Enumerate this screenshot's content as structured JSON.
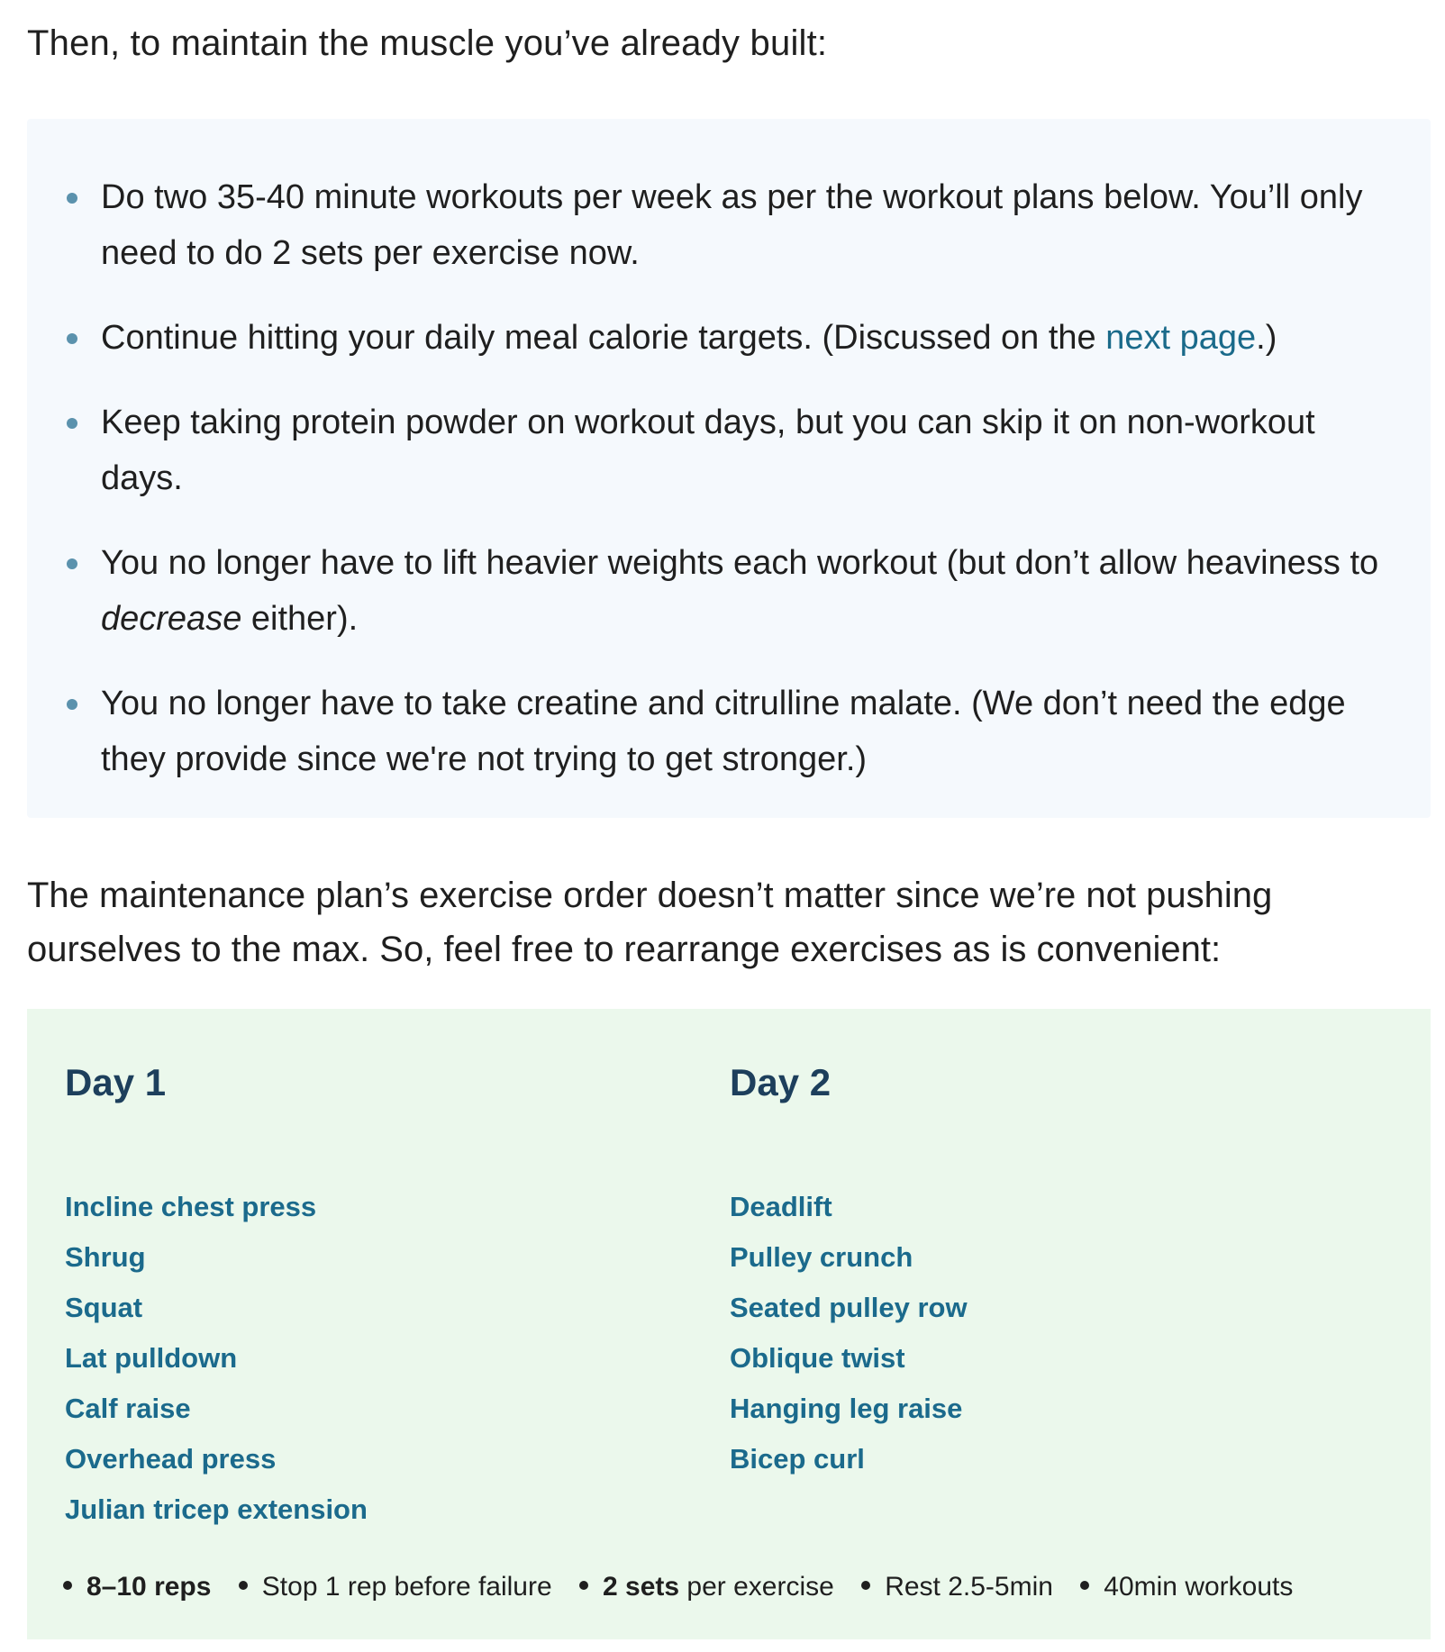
{
  "intro": "Then, to maintain the muscle you’ve already built:",
  "bullets": {
    "b1": "Do two 35-40 minute workouts per week as per the workout plans below. You’ll only need to do 2 sets per exercise now.",
    "b2_before": "Continue hitting your daily meal calorie targets. (Discussed on the ",
    "b2_link": "next page",
    "b2_after": ".)",
    "b3": "Keep taking protein powder on workout days, but you can skip it on non-workout days.",
    "b4_before": "You no longer have to lift heavier weights each workout (but don’t allow heaviness to ",
    "b4_em": "decrease",
    "b4_after": " either).",
    "b5": "You no longer have to take creatine and citrulline malate. (We don’t need the edge they provide since we're not trying to get stronger.)"
  },
  "paragraph": "The maintenance plan’s exercise order doesn’t matter since we’re not pushing ourselves to the max. So, feel free to rearrange exercises as is convenient:",
  "plan": {
    "day1": {
      "title": "Day 1",
      "exercises": [
        "Incline chest press",
        "Shrug",
        "Squat",
        "Lat pulldown",
        "Calf raise",
        "Overhead press",
        "Julian tricep extension"
      ]
    },
    "day2": {
      "title": "Day 2",
      "exercises": [
        "Deadlift",
        "Pulley crunch",
        "Seated pulley row",
        "Oblique twist",
        "Hanging leg raise",
        "Bicep curl"
      ]
    },
    "summary": {
      "reps": "8–10 reps",
      "failure": "Stop 1 rep before failure",
      "sets_bold": "2 sets",
      "sets_rest": " per exercise",
      "rest": "Rest 2.5-5min",
      "duration": "40min workouts"
    }
  }
}
